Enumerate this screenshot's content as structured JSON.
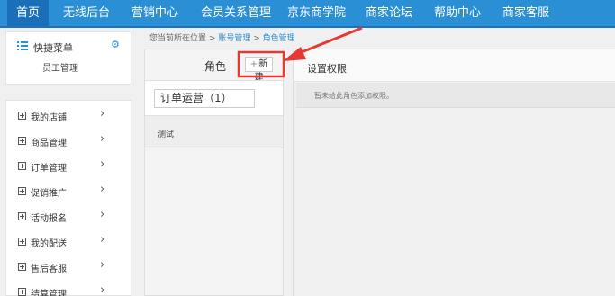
{
  "topnav": {
    "items": [
      "首页",
      "无线后台",
      "营销中心",
      "会员关系管理",
      "京东商学院",
      "商家论坛",
      "帮助中心",
      "商家客服"
    ]
  },
  "sidebar": {
    "quick_title": "快捷菜单",
    "quick_link": "员工管理",
    "items": [
      {
        "label": "我的店铺"
      },
      {
        "label": "商品管理"
      },
      {
        "label": "订单管理"
      },
      {
        "label": "促销推广"
      },
      {
        "label": "活动报名"
      },
      {
        "label": "我的配送"
      },
      {
        "label": "售后客服"
      },
      {
        "label": "结算管理"
      }
    ]
  },
  "breadcrumb": {
    "prefix": "您当前所在位置",
    "sep1": ">",
    "level1": "账号管理",
    "sep2": ">",
    "level2": "角色管理"
  },
  "role_panel": {
    "title": "角色",
    "new_button_plus": "+",
    "new_button": "新建",
    "role_input_value": "订单运营（1）",
    "role_item": "测试"
  },
  "perm_panel": {
    "title": "设置权限",
    "note": "暂未给此角色添加权限。"
  },
  "colors": {
    "nav_bg": "#2b8fd6",
    "nav_active": "#1a6fb8",
    "annotation_red": "#e53935"
  },
  "icons": {
    "quick_menu": "list-icon",
    "settings": "gear-icon",
    "expand": "plus-square-icon",
    "chevron": "chevron-right-icon"
  }
}
